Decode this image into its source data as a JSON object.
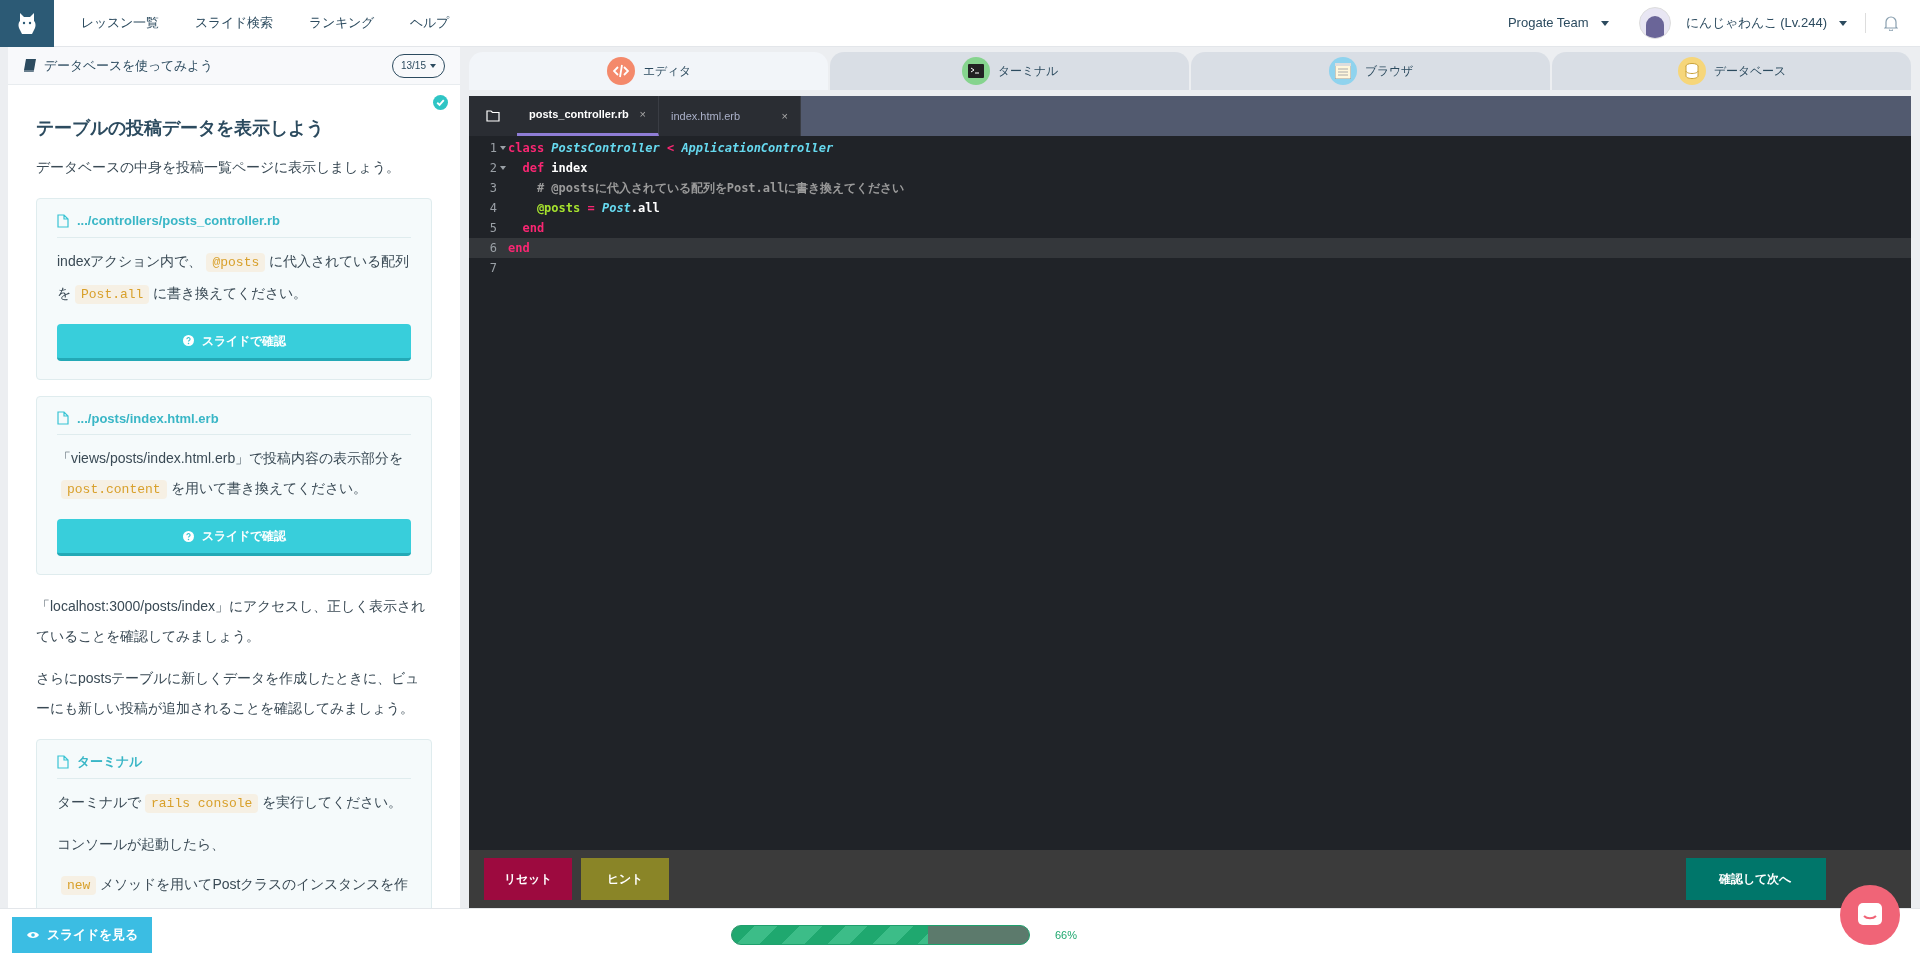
{
  "nav": {
    "links": [
      "レッスン一覧",
      "スライド検索",
      "ランキング",
      "ヘルプ"
    ],
    "team": "Progate Team",
    "user": "にんじゃわんこ (Lv.244)"
  },
  "lesson": {
    "title": "データベースを使ってみよう",
    "progress": "13/15",
    "completed": true,
    "heading": "テーブルの投稿データを表示しよう",
    "blocks": [
      {
        "kind": "paragraph",
        "lines": [
          [
            {
              "kind": "text",
              "text": "データベースの中身を投稿一覧ページに表示しましょう。"
            }
          ]
        ]
      },
      {
        "kind": "card",
        "file": ".../controllers/posts_controller.rb",
        "button": "スライドで確認",
        "paragraphs": [
          [
            {
              "kind": "text",
              "text": "indexアクション内で、"
            },
            {
              "kind": "code",
              "text": "@posts"
            },
            {
              "kind": "text",
              "text": "に代入されている配列を"
            },
            {
              "kind": "code",
              "text": "Post.all"
            },
            {
              "kind": "text",
              "text": "に書き換えてください。"
            }
          ]
        ]
      },
      {
        "kind": "card",
        "file": ".../posts/index.html.erb",
        "button": "スライドで確認",
        "paragraphs": [
          [
            {
              "kind": "text",
              "text": "「views/posts/index.html.erb」で投稿内容の表示部分を"
            },
            {
              "kind": "code",
              "text": "post.content"
            },
            {
              "kind": "text",
              "text": "を用いて書き換えてください。"
            }
          ]
        ]
      },
      {
        "kind": "paragraph",
        "lines": [
          [
            {
              "kind": "text",
              "text": "「localhost:3000/posts/index」にアクセスし、正しく表示されていることを確認してみましょう。"
            }
          ]
        ]
      },
      {
        "kind": "paragraph",
        "lines": [
          [
            {
              "kind": "text",
              "text": "さらにpostsテーブルに新しくデータを作成したときに、ビューにも新しい投稿が追加されることを確認してみましょう。"
            }
          ]
        ]
      },
      {
        "kind": "card",
        "file": "ターミナル",
        "paragraphs": [
          [
            {
              "kind": "text",
              "text": "ターミナルで"
            },
            {
              "kind": "code",
              "text": "rails console"
            },
            {
              "kind": "text",
              "text": "を実行してください。"
            }
          ],
          [
            {
              "kind": "text",
              "text": "コンソールが起動したら、"
            }
          ],
          [
            {
              "kind": "code",
              "text": "new"
            },
            {
              "kind": "text",
              "text": "メソッドを用いてPostクラスのインスタンスを作"
            }
          ]
        ]
      }
    ]
  },
  "slide_button": "スライドを見る",
  "panel_tabs": [
    {
      "label": "エディタ",
      "kind": "editor",
      "selected": true
    },
    {
      "label": "ターミナル",
      "kind": "terminal",
      "selected": false
    },
    {
      "label": "ブラウザ",
      "kind": "browser",
      "selected": false
    },
    {
      "label": "データベース",
      "kind": "database",
      "selected": false
    }
  ],
  "file_tabs": [
    {
      "label": "posts_controller.rb",
      "close": "×",
      "selected": true
    },
    {
      "label": "index.html.erb",
      "close": "×",
      "selected": false
    }
  ],
  "code_lines": [
    {
      "number": "1",
      "foldable": true,
      "active": false,
      "tokens": [
        {
          "kind": "keyword",
          "text": "class"
        },
        {
          "kind": "class",
          "text": " PostsController"
        },
        {
          "kind": "keyword",
          "text": " <"
        },
        {
          "kind": "class",
          "text": " ApplicationController"
        }
      ]
    },
    {
      "number": "2",
      "foldable": true,
      "active": false,
      "tokens": [
        {
          "kind": "keyword",
          "text": "  def"
        },
        {
          "kind": "method",
          "text": " index"
        }
      ]
    },
    {
      "number": "3",
      "foldable": false,
      "active": false,
      "tokens": [
        {
          "kind": "comment",
          "text": "    # @postsに代入されている配列をPost.allに書き換えてください"
        }
      ]
    },
    {
      "number": "4",
      "foldable": false,
      "active": false,
      "tokens": [
        {
          "kind": "ivar",
          "text": "    @posts"
        },
        {
          "kind": "keyword",
          "text": " ="
        },
        {
          "kind": "class",
          "text": " Post"
        },
        {
          "kind": "method",
          "text": ".all"
        }
      ]
    },
    {
      "number": "5",
      "foldable": false,
      "active": false,
      "tokens": [
        {
          "kind": "keyword",
          "text": "  end"
        }
      ]
    },
    {
      "number": "6",
      "foldable": false,
      "active": true,
      "tokens": [
        {
          "kind": "keyword",
          "text": "end"
        }
      ]
    },
    {
      "number": "7",
      "foldable": false,
      "active": false
    }
  ],
  "actions": {
    "reset": "リセット",
    "hint": "ヒント",
    "next": "確認して次へ"
  },
  "progress": {
    "level": 0.66,
    "label": "66%"
  }
}
